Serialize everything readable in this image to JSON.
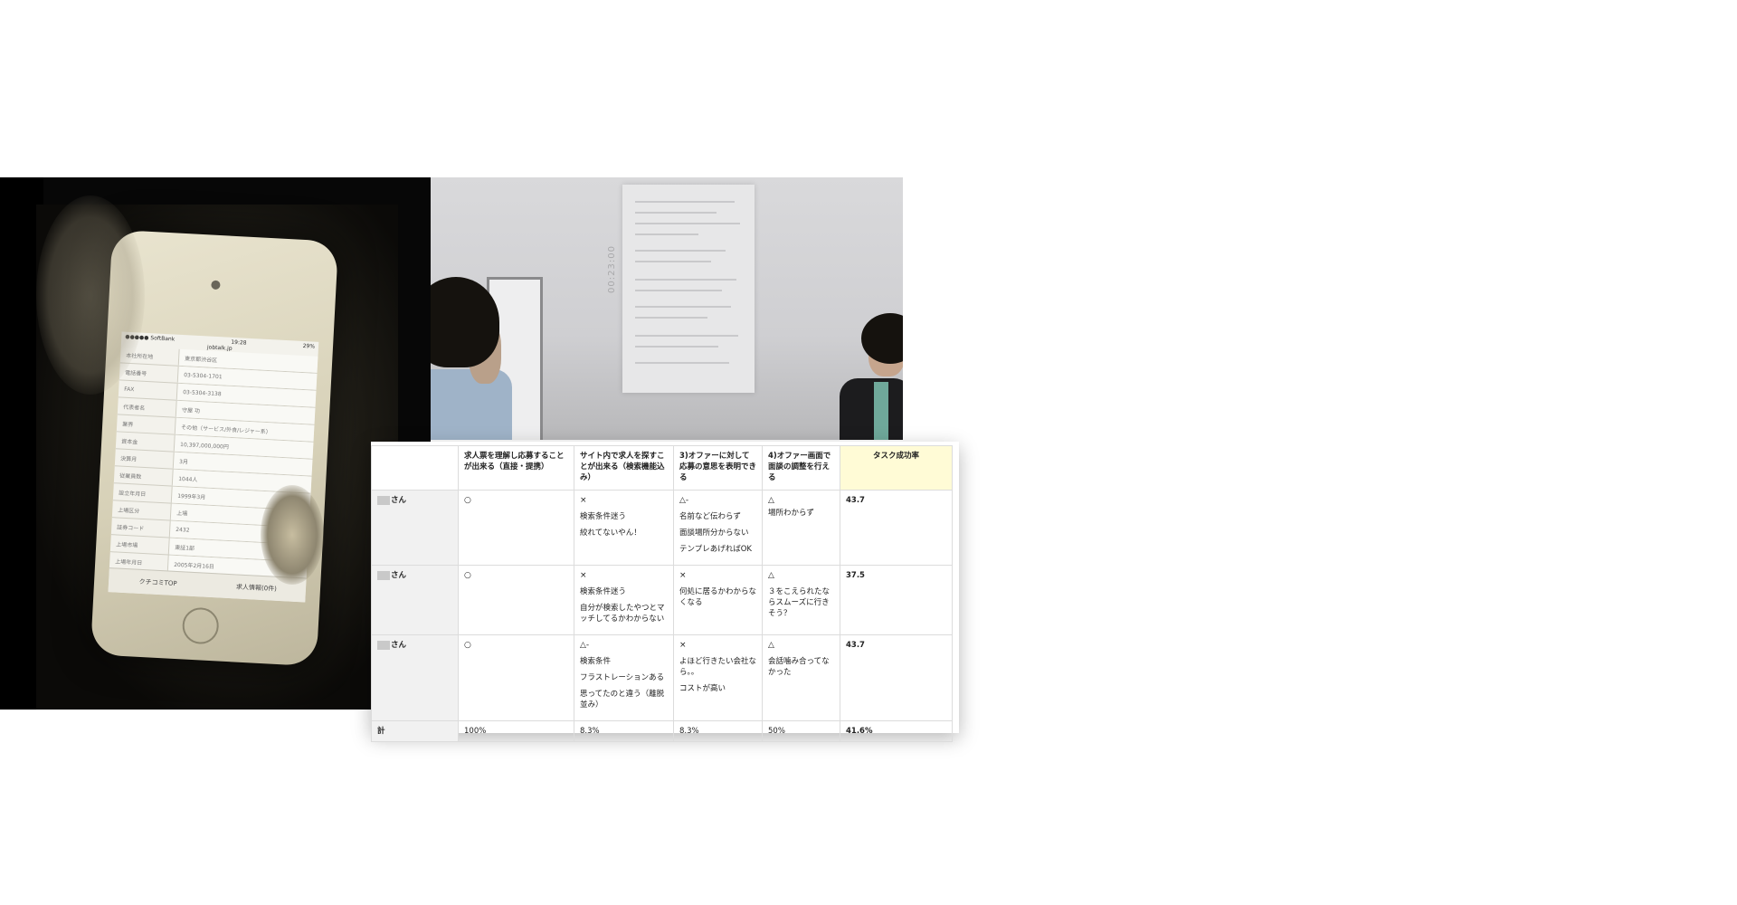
{
  "phone": {
    "status": {
      "carrier": "●●●●● SoftBank",
      "time": "19:28",
      "battery": "29%"
    },
    "site": "jobtalk.jp",
    "specs": [
      {
        "label": "本社所在地",
        "value": "東京都渋谷区"
      },
      {
        "label": "電話番号",
        "value": "03-5304-1701"
      },
      {
        "label": "FAX",
        "value": "03-5304-3138"
      },
      {
        "label": "代表者名",
        "value": "守屋 功"
      },
      {
        "label": "業界",
        "value": "その他（サービス/外食/レジャー系）"
      },
      {
        "label": "資本金",
        "value": "10,397,000,000円"
      },
      {
        "label": "決算月",
        "value": "3月"
      },
      {
        "label": "従業員数",
        "value": "1044人"
      },
      {
        "label": "設立年月日",
        "value": "1999年3月"
      },
      {
        "label": "上場区分",
        "value": "上場"
      },
      {
        "label": "証券コード",
        "value": "2432"
      },
      {
        "label": "上場市場",
        "value": "東証1部"
      },
      {
        "label": "上場年月日",
        "value": "2005年2月16日"
      }
    ],
    "buttons": {
      "left": "クチコミTOP",
      "right": "求人情報(0件)"
    }
  },
  "room": {
    "timestamp": "00:23:00"
  },
  "table": {
    "headers": {
      "name": "",
      "task1": "求人票を理解し応募することが出来る（直接・提携）",
      "task2": "サイト内で求人を探すことが出来る（検索機能込み）",
      "task3": "3)オファーに対して応募の意思を表明できる",
      "task4": "4)オファー画面で面談の調整を行える",
      "rate": "タスク成功率"
    },
    "rows": [
      {
        "name": "さん",
        "t1": {
          "mark": "○",
          "notes": []
        },
        "t2": {
          "mark": "×",
          "notes": [
            "検索条件迷う",
            "絞れてないやん！"
          ]
        },
        "t3": {
          "mark": "△-",
          "notes": [
            "名前など伝わらず",
            "面談場所分からない",
            "テンプレあげればOK"
          ]
        },
        "t4": {
          "mark": "△",
          "notes": [
            "場所わからず"
          ]
        },
        "rate": "43.7"
      },
      {
        "name": "さん",
        "t1": {
          "mark": "○",
          "notes": []
        },
        "t2": {
          "mark": "×",
          "notes": [
            "検索条件迷う",
            "自分が検索したやつとマッチしてるかわからない"
          ]
        },
        "t3": {
          "mark": "×",
          "notes": [
            "何処に居るかわからなくなる"
          ]
        },
        "t4": {
          "mark": "△",
          "notes": [
            "３をこえられたならスムーズに行きそう？"
          ]
        },
        "rate": "37.5"
      },
      {
        "name": "さん",
        "t1": {
          "mark": "○",
          "notes": []
        },
        "t2": {
          "mark": "△-",
          "notes": [
            "検索条件",
            "フラストレーションある",
            "思ってたのと違う（離脱並み）"
          ]
        },
        "t3": {
          "mark": "×",
          "notes": [
            "よほど行きたい会社なら。。",
            "コストが高い"
          ]
        },
        "t4": {
          "mark": "△",
          "notes": [
            "会話噛み合ってなかった"
          ]
        },
        "rate": "43.7"
      }
    ],
    "total": {
      "label": "計",
      "t1": "100%",
      "t2": "8.3%",
      "t3": "8.3%",
      "t4": "50%",
      "rate": "41.6%"
    }
  }
}
